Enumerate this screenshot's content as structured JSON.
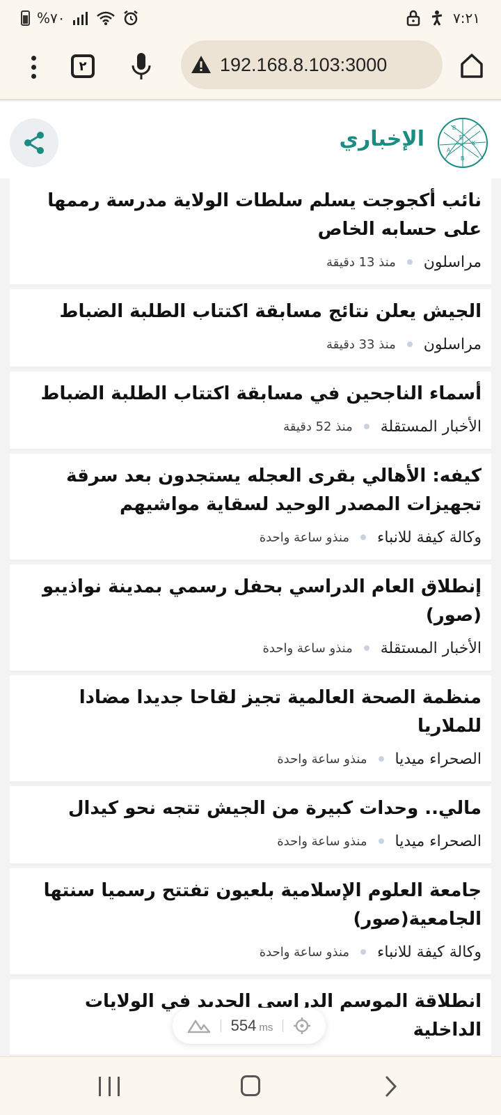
{
  "status_bar": {
    "battery_text": "%٧٠",
    "time": "٧:٢١",
    "icons": [
      "battery-icon",
      "signal-icon",
      "wifi-icon",
      "alarm-icon",
      "lock-icon",
      "accessibility-icon"
    ]
  },
  "browser": {
    "url": "192.168.8.103:3000",
    "tab_count": "٢",
    "icons": [
      "more-vert-icon",
      "tabs-icon",
      "mic-icon",
      "warning-icon",
      "home-icon"
    ]
  },
  "site": {
    "brand": "الإخباري",
    "logo_letters": [
      "B",
      "E",
      "K",
      "A",
      "B"
    ],
    "accent_color": "#1a8c82"
  },
  "articles": [
    {
      "title": "نائب أكجوجت يسلم سلطات الولاية مدرسة رممها على حسابه الخاص",
      "source": "مراسلون",
      "time": "منذ 13 دقيقة"
    },
    {
      "title": "الجيش يعلن نتائج مسابقة اكتتاب الطلبة الضباط",
      "source": "مراسلون",
      "time": "منذ 33 دقيقة"
    },
    {
      "title": "أسماء الناجحين في مسابقة اكتتاب الطلبة الضباط",
      "source": "الأخبار المستقلة",
      "time": "منذ 52 دقيقة"
    },
    {
      "title": "كيفه: الأهالي بقرى العجله يستجدون بعد سرقة تجهيزات المصدر الوحيد لسقاية مواشيهم",
      "source": "وكالة كيفة للانباء",
      "time": "منذو ساعة واحدة"
    },
    {
      "title": "إنطلاق العام الدراسي بحفل رسمي بمدينة نواذيبو (صور)",
      "source": "الأخبار المستقلة",
      "time": "منذو ساعة واحدة"
    },
    {
      "title": "منظمة الصحة العالمية تجيز لقاحا جديدا مضادا للملاريا",
      "source": "الصحراء ميديا",
      "time": "منذو ساعة واحدة"
    },
    {
      "title": "مالي.. وحدات كبيرة من الجيش تتجه نحو كيدال",
      "source": "الصحراء ميديا",
      "time": "منذو ساعة واحدة"
    },
    {
      "title": "جامعة العلوم الإسلامية بلعيون تفتتح رسميا سنتها الجامعية(صور)",
      "source": "وكالة كيفة للانباء",
      "time": "منذو ساعة واحدة"
    },
    {
      "title": "انطلاقة الموسم الدراسي الجديد في الولايات الداخلية",
      "source": "",
      "time": ""
    }
  ],
  "perf_overlay": {
    "value": "554",
    "unit": "ms"
  },
  "nav_bar": {
    "icons": [
      "recents-icon",
      "home-icon",
      "back-icon"
    ]
  }
}
